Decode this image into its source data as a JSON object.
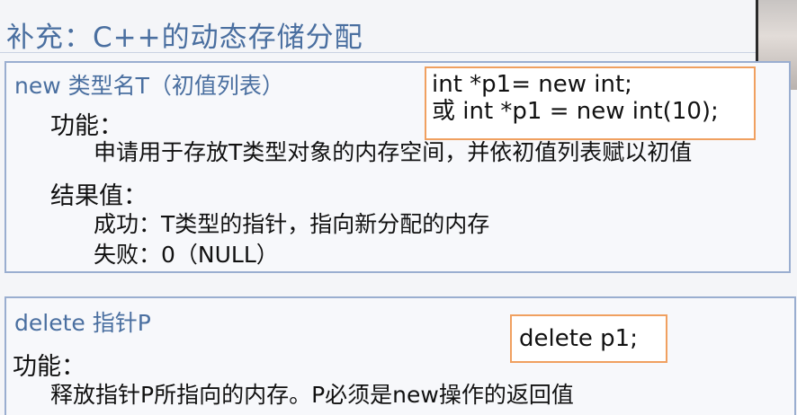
{
  "slide": {
    "title": "补充：C++的动态存储分配",
    "new_section": {
      "syntax": "new  类型名T（初值列表）",
      "code_line1": "int *p1= new int;",
      "code_line2": "或 int *p1 = new int(10);",
      "function_label": "功能：",
      "function_desc": "申请用于存放T类型对象的内存空间，并依初值列表赋以初值",
      "result_label": "结果值：",
      "success_text": "成功：T类型的指针，指向新分配的内存",
      "fail_text": "失败：0（NULL）"
    },
    "delete_section": {
      "syntax": "delete 指针P",
      "code": "delete p1;",
      "function_label": "功能：",
      "function_desc": "释放指针P所指向的内存。P必须是new操作的返回值"
    }
  }
}
